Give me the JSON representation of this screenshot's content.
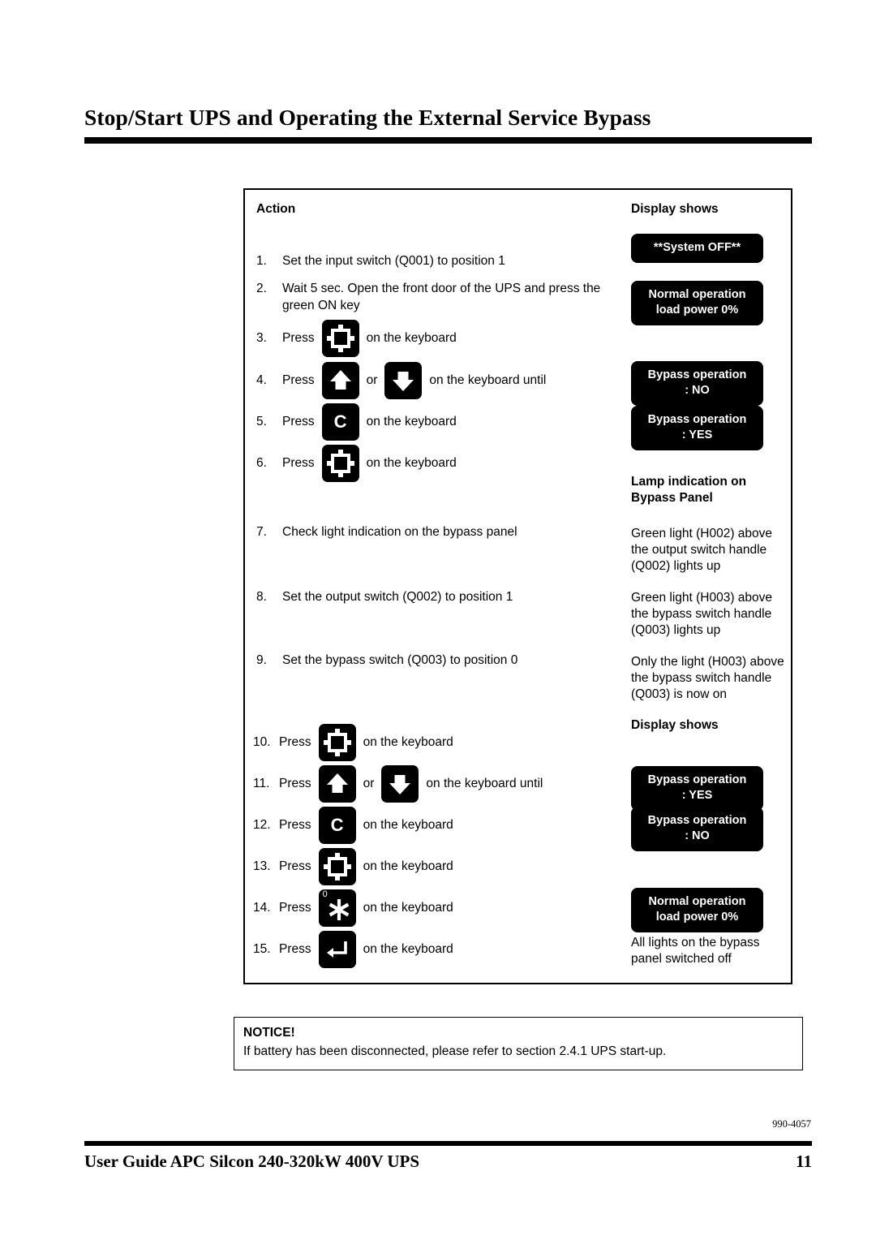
{
  "page": {
    "title": "Stop/Start UPS and Operating the External Service Bypass",
    "doc_code": "990-4057",
    "footer_text": "User Guide APC Silcon 240-320kW 400V UPS",
    "page_number": "11"
  },
  "table": {
    "col_action_header": "Action",
    "col_display_header": "Display shows",
    "steps": [
      {
        "num": "1.",
        "lead": "Set the input switch (Q001) to position 1"
      },
      {
        "num": "2.",
        "lead": "Wait 5 sec. Open the front door of the UPS and press the green ON key"
      },
      {
        "num": "3.",
        "lead": "Press",
        "key": "frame-key",
        "tail": "on the keyboard"
      },
      {
        "num": "4.",
        "lead": "Press",
        "key": "arrow-up-key",
        "mid": "or",
        "key2": "arrow-down-key",
        "tail": "on the keyboard until"
      },
      {
        "num": "5.",
        "lead": "Press",
        "key": "c-key",
        "tail": "on the keyboard"
      },
      {
        "num": "6.",
        "lead": "Press",
        "key": "frame-key",
        "tail": "on the keyboard"
      },
      {
        "num": "7.",
        "lead": "Check light indication on the bypass panel"
      },
      {
        "num": "8.",
        "lead": "Set the output switch (Q002) to position 1"
      },
      {
        "num": "9.",
        "lead": "Set the bypass switch (Q003) to position 0"
      },
      {
        "num": "10.",
        "lead": "Press",
        "key": "frame-key",
        "tail": "on the keyboard"
      },
      {
        "num": "11.",
        "lead": "Press",
        "key": "arrow-up-key",
        "mid": "or",
        "key2": "arrow-down-key",
        "tail": "on the keyboard until"
      },
      {
        "num": "12.",
        "lead": "Press",
        "key": "c-key",
        "tail": "on the keyboard"
      },
      {
        "num": "13.",
        "lead": "Press",
        "key": "frame-key",
        "tail": "on the keyboard"
      },
      {
        "num": "14.",
        "lead": "Press",
        "key": "asterisk-zero-key",
        "tail": "on the keyboard"
      },
      {
        "num": "15.",
        "lead": "Press",
        "key": "enter-key",
        "tail": "on the keyboard"
      }
    ],
    "display_badges": [
      {
        "line1": "**System OFF**",
        "line2": ""
      },
      {
        "line1": "Normal operation",
        "line2": "load power 0%"
      },
      {
        "line1": "Bypass operation",
        "line2": ": NO"
      },
      {
        "line1": "Bypass operation",
        "line2": ": YES"
      },
      {
        "line1": "Bypass operation",
        "line2": ": YES"
      },
      {
        "line1": "Bypass operation",
        "line2": ": NO"
      },
      {
        "line1": "Normal operation",
        "line2": "load power 0%"
      }
    ],
    "display_headings": [
      {
        "text": "Lamp indication on Bypass Panel"
      },
      {
        "text": "Display shows"
      }
    ],
    "display_texts": [
      {
        "text": "Green light (H002) above the output switch handle (Q002) lights up"
      },
      {
        "text": "Green light (H003) above the bypass switch handle (Q003) lights up"
      },
      {
        "text": "Only the light (H003) above the bypass switch handle (Q003) is now on"
      },
      {
        "text": "All lights on the bypass panel switched off"
      }
    ],
    "key_symbols": {
      "c_label": "C",
      "asterisk_superscript": "0"
    }
  },
  "notice": {
    "title": "NOTICE!",
    "body": "If battery has been disconnected, please refer to section 2.4.1 UPS start-up."
  },
  "colors": {
    "ink": "#000000",
    "paper": "#ffffff",
    "badge_bg": "#000000",
    "badge_fg": "#ffffff"
  }
}
